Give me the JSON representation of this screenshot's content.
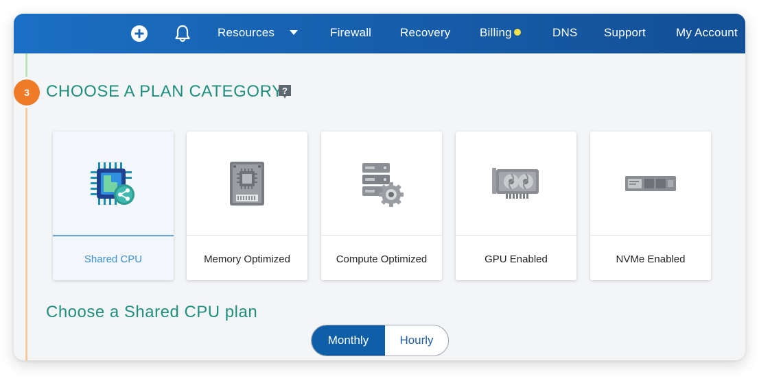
{
  "nav": {
    "items": [
      {
        "label": "Resources",
        "has_dropdown": true
      },
      {
        "label": "Firewall"
      },
      {
        "label": "Recovery"
      },
      {
        "label": "Billing",
        "has_notification_dot": true
      },
      {
        "label": "DNS"
      },
      {
        "label": "Support"
      },
      {
        "label": "My Account"
      }
    ],
    "icons": [
      "plus-circle-icon",
      "bell-icon"
    ],
    "background_color": "#1760ae",
    "notification_dot_color": "#f4e14a"
  },
  "step": {
    "number": "3",
    "title": "CHOOSE A PLAN CATEGORY",
    "badge_color": "#f07b26",
    "title_color": "#1f8f7e"
  },
  "categories": [
    {
      "label": "Shared CPU",
      "icon": "shared-cpu-chip-icon",
      "selected": true
    },
    {
      "label": "Memory Optimized",
      "icon": "memory-module-icon",
      "selected": false
    },
    {
      "label": "Compute Optimized",
      "icon": "server-gear-icon",
      "selected": false
    },
    {
      "label": "GPU Enabled",
      "icon": "gpu-card-icon",
      "selected": false
    },
    {
      "label": "NVMe Enabled",
      "icon": "nvme-drive-icon",
      "selected": false
    }
  ],
  "plan": {
    "title": "Choose a Shared CPU plan",
    "billing_toggle": {
      "options": [
        "Monthly",
        "Hourly"
      ],
      "selected": "Monthly",
      "active_color": "#0f5ea8"
    }
  }
}
